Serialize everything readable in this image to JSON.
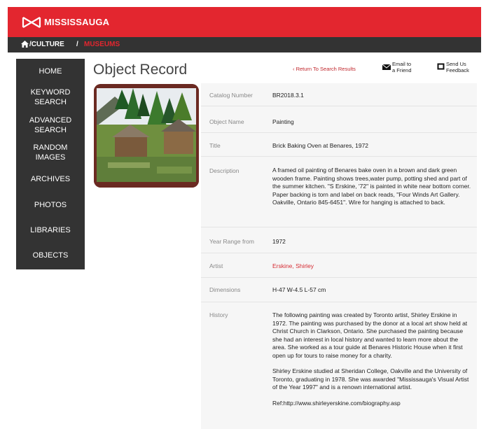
{
  "header": {
    "brand": "MISSISSAUGA",
    "breadcrumb": {
      "culture": "/CULTURE",
      "sep": "/",
      "museums": "MUSEUMS"
    },
    "brand_color": "#e3262f"
  },
  "nav": [
    {
      "label": "HOME"
    },
    {
      "label": "KEYWORD SEARCH"
    },
    {
      "label": "ADVANCED SEARCH"
    },
    {
      "label": "RANDOM IMAGES"
    },
    {
      "label": "ARCHIVES"
    },
    {
      "label": "PHOTOS"
    },
    {
      "label": "LIBRARIES"
    },
    {
      "label": "OBJECTS"
    }
  ],
  "page": {
    "title": "Object Record",
    "return_link": "‹ Return To Search Results",
    "email_line1": "Email to",
    "email_line2": "a Friend",
    "feedback_line1": "Send Us",
    "feedback_line2": "Feedback"
  },
  "record": {
    "catalog_number": {
      "label": "Catalog Number",
      "value": "BR2018.3.1"
    },
    "object_name": {
      "label": "Object Name",
      "value": "Painting"
    },
    "title": {
      "label": "Title",
      "value": "Brick Baking Oven at Benares, 1972"
    },
    "description": {
      "label": "Description",
      "value": "A framed oil painting of Benares bake oven in a brown and dark green wooden frame. Painting shows trees,water pump, potting shed and part of the summer kitchen. \"S Erskine, '72\" is painted in white near bottom corner. Paper backing is torn and label on back reads, \"Four Winds Art Gallery. Oakville, Ontario 845-6451\". Wire for hanging is attached to back."
    },
    "year_range": {
      "label": "Year Range from",
      "value": "1972"
    },
    "artist": {
      "label": "Artist",
      "value": "Erskine, Shirley"
    },
    "dimensions": {
      "label": "Dimensions",
      "value": "H-47 W-4.5 L-57 cm"
    },
    "history": {
      "label": "History",
      "p1": "The following painting was created by Toronto artist, Shirley Erskine in 1972. The painting was purchased by the donor at a local art show held at Christ Church in Clarkson, Ontario. She purchased the painting because she had an interest in local history and wanted to learn more about the area. She worked as a tour guide at Benares Historic House when it first open up for tours to raise money for a charity.",
      "p2": "Shirley Erskine studied at Sheridan College, Oakville and the University of Toronto, graduating in 1978. She was awarded \"Mississauga's Visual Artist of the Year 1997\" and is a renown international artist.",
      "p3": "Ref:http://www.shirleyerskine.com/biography.asp"
    }
  }
}
